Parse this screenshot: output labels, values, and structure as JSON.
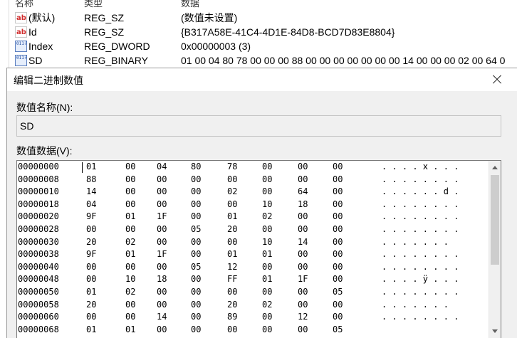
{
  "registry": {
    "columns": {
      "name": "名称",
      "type": "类型",
      "data": "数据"
    },
    "rows": [
      {
        "icon": "string-value-icon",
        "name": "(默认)",
        "type": "REG_SZ",
        "data": "(数值未设置)"
      },
      {
        "icon": "string-value-icon",
        "name": "Id",
        "type": "REG_SZ",
        "data": "{B317A58E-41C4-4D1E-84D8-BCD7D83E8804}"
      },
      {
        "icon": "binary-value-icon",
        "name": "Index",
        "type": "REG_DWORD",
        "data": "0x00000003 (3)"
      },
      {
        "icon": "binary-value-icon",
        "name": "SD",
        "type": "REG_BINARY",
        "data": "01 00 04 80 78 00 00 00 88 00 00 00 00 00 00 00 14 00 00 00 02 00 64 0"
      }
    ]
  },
  "dialog": {
    "title": "编辑二进制数值",
    "value_name_label": "数值名称(N):",
    "value_name": "SD",
    "value_data_label": "数值数据(V):",
    "hex_rows": [
      {
        "addr": "00000000",
        "bytes": [
          "01",
          "00",
          "04",
          "80",
          "78",
          "00",
          "00",
          "00"
        ],
        "ascii": ". . . . x . . ."
      },
      {
        "addr": "00000008",
        "bytes": [
          "88",
          "00",
          "00",
          "00",
          "00",
          "00",
          "00",
          "00"
        ],
        "ascii": ". . . . . . . ."
      },
      {
        "addr": "00000010",
        "bytes": [
          "14",
          "00",
          "00",
          "00",
          "02",
          "00",
          "64",
          "00"
        ],
        "ascii": ". . . . . . d ."
      },
      {
        "addr": "00000018",
        "bytes": [
          "04",
          "00",
          "00",
          "00",
          "00",
          "10",
          "18",
          "00"
        ],
        "ascii": ". . . . . . . ."
      },
      {
        "addr": "00000020",
        "bytes": [
          "9F",
          "01",
          "1F",
          "00",
          "01",
          "02",
          "00",
          "00"
        ],
        "ascii": ". . . . . . . ."
      },
      {
        "addr": "00000028",
        "bytes": [
          "00",
          "00",
          "00",
          "05",
          "20",
          "00",
          "00",
          "00"
        ],
        "ascii": ". . . . . . . ."
      },
      {
        "addr": "00000030",
        "bytes": [
          "20",
          "02",
          "00",
          "00",
          "00",
          "10",
          "14",
          "00"
        ],
        "ascii": ". . . . . . ."
      },
      {
        "addr": "00000038",
        "bytes": [
          "9F",
          "01",
          "1F",
          "00",
          "01",
          "01",
          "00",
          "00"
        ],
        "ascii": ". . . . . . . ."
      },
      {
        "addr": "00000040",
        "bytes": [
          "00",
          "00",
          "00",
          "05",
          "12",
          "00",
          "00",
          "00"
        ],
        "ascii": ". . . . . . . ."
      },
      {
        "addr": "00000048",
        "bytes": [
          "00",
          "10",
          "18",
          "00",
          "FF",
          "01",
          "1F",
          "00"
        ],
        "ascii": ". . . . ÿ . . ."
      },
      {
        "addr": "00000050",
        "bytes": [
          "01",
          "02",
          "00",
          "00",
          "00",
          "00",
          "00",
          "05"
        ],
        "ascii": ". . . . . . . ."
      },
      {
        "addr": "00000058",
        "bytes": [
          "20",
          "00",
          "00",
          "00",
          "20",
          "02",
          "00",
          "00"
        ],
        "ascii": ". . . . . . ."
      },
      {
        "addr": "00000060",
        "bytes": [
          "00",
          "00",
          "14",
          "00",
          "89",
          "00",
          "12",
          "00"
        ],
        "ascii": ". . . . . . . ."
      },
      {
        "addr": "00000068",
        "bytes": [
          "01",
          "01",
          "00",
          "00",
          "00",
          "00",
          "00",
          "05"
        ],
        "ascii": ""
      }
    ]
  }
}
